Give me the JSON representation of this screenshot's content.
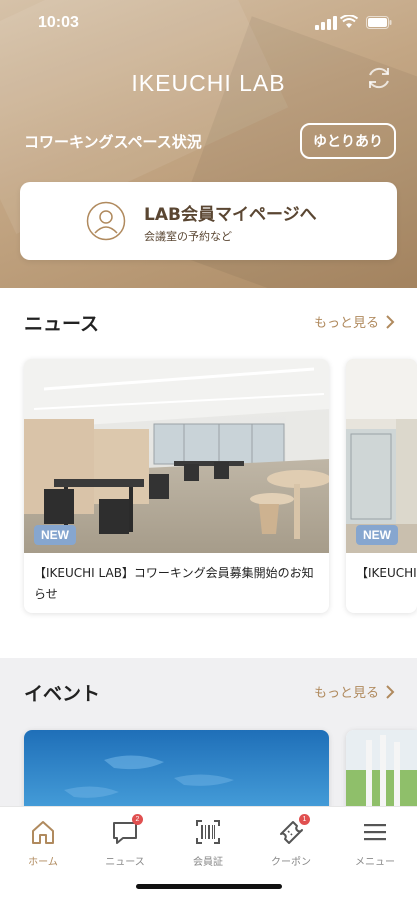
{
  "status": {
    "time": "10:03"
  },
  "header": {
    "brand": "IKEUCHI LAB",
    "space_label": "コワーキングスペース状況",
    "space_status": "ゆとりあり",
    "mypage_title": "LAB会員マイページへ",
    "mypage_sub": "会議室の予約など"
  },
  "news": {
    "title": "ニュース",
    "more": "もっと見る",
    "cards": [
      {
        "badge": "NEW",
        "text": "【IKEUCHI LAB】コワーキング会員募集開始のお知らせ"
      },
      {
        "badge": "NEW",
        "text": "【IKEUCHI LAB】ンの実施"
      }
    ]
  },
  "event": {
    "title": "イベント",
    "more": "もっと見る"
  },
  "tabbar": {
    "items": [
      {
        "label": "ホーム",
        "icon": "home-icon",
        "active": true
      },
      {
        "label": "ニュース",
        "icon": "chat-icon",
        "badge": "2"
      },
      {
        "label": "会員証",
        "icon": "barcode-icon"
      },
      {
        "label": "クーポン",
        "icon": "ticket-icon",
        "badge": "1"
      },
      {
        "label": "メニュー",
        "icon": "menu-icon"
      }
    ]
  },
  "colors": {
    "accent": "#b08a5e",
    "header": "#c3a684",
    "new_badge": "#86a6cf",
    "notif": "#e05050"
  }
}
